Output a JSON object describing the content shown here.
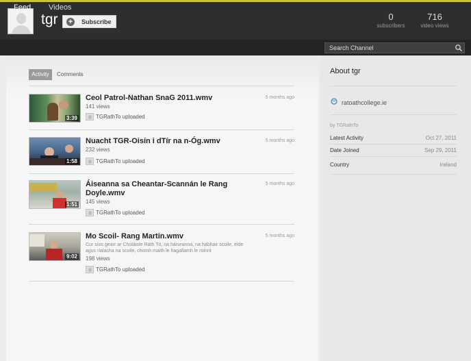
{
  "header": {
    "channel_name": "tgr",
    "subscribe_label": "Subscribe",
    "stats": {
      "subscribers_count": "0",
      "subscribers_label": "subscribers",
      "views_count": "716",
      "views_label": "video views"
    }
  },
  "nav": {
    "tabs": [
      {
        "label": "Feed",
        "active": true
      },
      {
        "label": "Videos",
        "active": false
      }
    ],
    "search_placeholder": "Search Channel"
  },
  "feed": {
    "subtabs": [
      {
        "label": "Activity",
        "active": true
      },
      {
        "label": "Comments",
        "active": false
      }
    ],
    "items": [
      {
        "title": "Ceol Patrol-Nathan SnaG 2011.wmv",
        "views": "141 views",
        "time_ago": "5 months ago",
        "duration": "3:39",
        "uploader": "TGRathTo uploaded",
        "description": ""
      },
      {
        "title": "Nuacht TGR-Oisín i dTír na n-Óg.wmv",
        "views": "232 views",
        "time_ago": "5 months ago",
        "duration": "1:58",
        "uploader": "TGRathTo uploaded",
        "description": ""
      },
      {
        "title": "Áiseanna sa Cheantar-Scannán le Rang Doyle.wmv",
        "views": "145 views",
        "time_ago": "5 months ago",
        "duration": "1:51",
        "uploader": "TGRathTo uploaded",
        "description": ""
      },
      {
        "title": "Mo Scoil- Rang Martin.wmv",
        "views": "198 views",
        "time_ago": "5 months ago",
        "duration": "9:02",
        "uploader": "TGRathTo uploaded",
        "description": "Cur síos gearr ar Choláiste Ráth Tó, na háiseanna, na hábhair scoile, éide agus rialacha na scoile, chomh maith le hagallamh le roinnt"
      }
    ]
  },
  "about": {
    "title": "About tgr",
    "website": "ratoathcollege.ie",
    "by": "by TGRathTo",
    "meta": [
      {
        "label": "Latest Activity",
        "value": "Oct 27, 2011"
      },
      {
        "label": "Date Joined",
        "value": "Sep 29, 2011"
      },
      {
        "label": "Country",
        "value": "Ireland"
      }
    ]
  },
  "colors": {
    "header_bg": "#2e2e2e",
    "accent_top": "#c9c43a",
    "navbar_bg": "#232323"
  }
}
